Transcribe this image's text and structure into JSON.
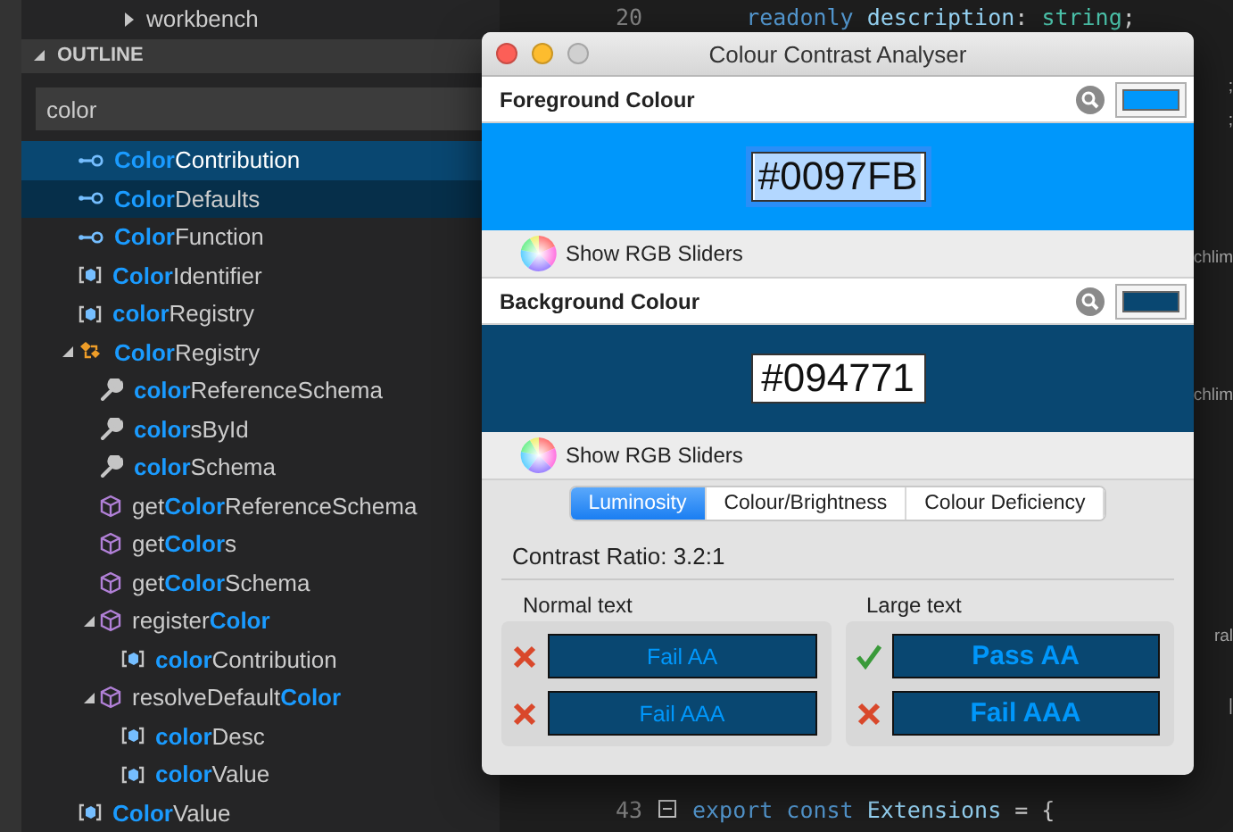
{
  "sidebar": {
    "explorer_item": {
      "label": "workbench",
      "expanded": false
    },
    "outline": {
      "title": "OUTLINE",
      "expanded": true,
      "filter": {
        "value": "color"
      },
      "items": [
        {
          "name": "**Color**Contribution",
          "kind": "field",
          "selected": true,
          "focused": false
        },
        {
          "name": "**Color**Defaults",
          "kind": "field",
          "selected": false,
          "focused": true
        },
        {
          "name": "**Color**Function",
          "kind": "field",
          "selected": false,
          "focused": false
        },
        {
          "name": "**Color**Identifier",
          "kind": "variable",
          "selected": false,
          "focused": false
        },
        {
          "name": "**color**Registry",
          "kind": "variable",
          "selected": false,
          "focused": false
        },
        {
          "name": "**Color**Registry",
          "kind": "class",
          "selected": false,
          "focused": false,
          "expanded": true,
          "children": [
            {
              "name": "**color**ReferenceSchema",
              "kind": "property",
              "selected": false,
              "focused": false
            },
            {
              "name": "**color**sById",
              "kind": "property",
              "selected": false,
              "focused": false
            },
            {
              "name": "**color**Schema",
              "kind": "property",
              "selected": false,
              "focused": false
            },
            {
              "name": "get**Color**ReferenceSchema",
              "kind": "method",
              "selected": false,
              "focused": false
            },
            {
              "name": "get**Color**s",
              "kind": "method",
              "selected": false,
              "focused": false
            },
            {
              "name": "get**Color**Schema",
              "kind": "method",
              "selected": false,
              "focused": false
            },
            {
              "name": "register**Color**",
              "kind": "method",
              "selected": false,
              "focused": false,
              "expanded": true,
              "children": [
                {
                  "name": "**color**Contribution",
                  "kind": "variable",
                  "selected": false,
                  "focused": false
                }
              ]
            },
            {
              "name": "resolveDefault**Color**",
              "kind": "method",
              "selected": false,
              "focused": false,
              "expanded": true,
              "children": [
                {
                  "name": "**color**Desc",
                  "kind": "variable",
                  "selected": false,
                  "focused": false
                },
                {
                  "name": "**color**Value",
                  "kind": "variable",
                  "selected": false,
                  "focused": false
                }
              ]
            }
          ]
        },
        {
          "name": "**Color**Value",
          "kind": "variable",
          "selected": false,
          "focused": false
        }
      ]
    }
  },
  "editor": {
    "lines": [
      {
        "number": "20",
        "tokens": [
          {
            "text": "    readonly",
            "kind": "keyword"
          },
          {
            "text": " description",
            "kind": "property"
          },
          {
            "text": ": ",
            "kind": "punct"
          },
          {
            "text": "string",
            "kind": "type"
          },
          {
            "text": ";",
            "kind": "punct"
          }
        ]
      },
      {
        "tail": ";"
      },
      {
        "tail": ";"
      },
      {
        "tail": "chlim"
      },
      {
        "tail": "chlim"
      },
      {
        "tail": "ral"
      },
      {
        "tail": "|"
      },
      {
        "number": "43",
        "folded": false,
        "tokens": [
          {
            "text": "export",
            "kind": "keyword"
          },
          {
            "text": " const",
            "kind": "keyword"
          },
          {
            "text": " Extensions",
            "kind": "property"
          },
          {
            "text": " = {",
            "kind": "punct"
          }
        ]
      }
    ]
  },
  "dialog": {
    "title": "Colour Contrast Analyser",
    "colors": [
      {
        "label": "Foreground Colour",
        "hex": "#0097FB",
        "color": "#0097fb",
        "text_highlighted": true,
        "sliders_label": "Show RGB Sliders"
      },
      {
        "label": "Background Colour",
        "hex": "#094771",
        "color": "#094771",
        "text_highlighted": false,
        "sliders_label": "Show RGB Sliders"
      }
    ],
    "tabs": [
      {
        "label": "Luminosity",
        "selected": true
      },
      {
        "label": "Colour/Brightness",
        "selected": false
      },
      {
        "label": "Colour Deficiency",
        "selected": false
      }
    ],
    "contrast_ratio": "Contrast Ratio: 3.2:1",
    "groups": [
      {
        "title": "Normal text",
        "kind": "normal",
        "results": [
          {
            "label": "Fail AA",
            "passed": false
          },
          {
            "label": "Fail AAA",
            "passed": false
          }
        ]
      },
      {
        "title": "Large text",
        "kind": "large",
        "results": [
          {
            "label": "Pass AA",
            "passed": true
          },
          {
            "label": "Fail AAA",
            "passed": false
          }
        ]
      }
    ]
  }
}
